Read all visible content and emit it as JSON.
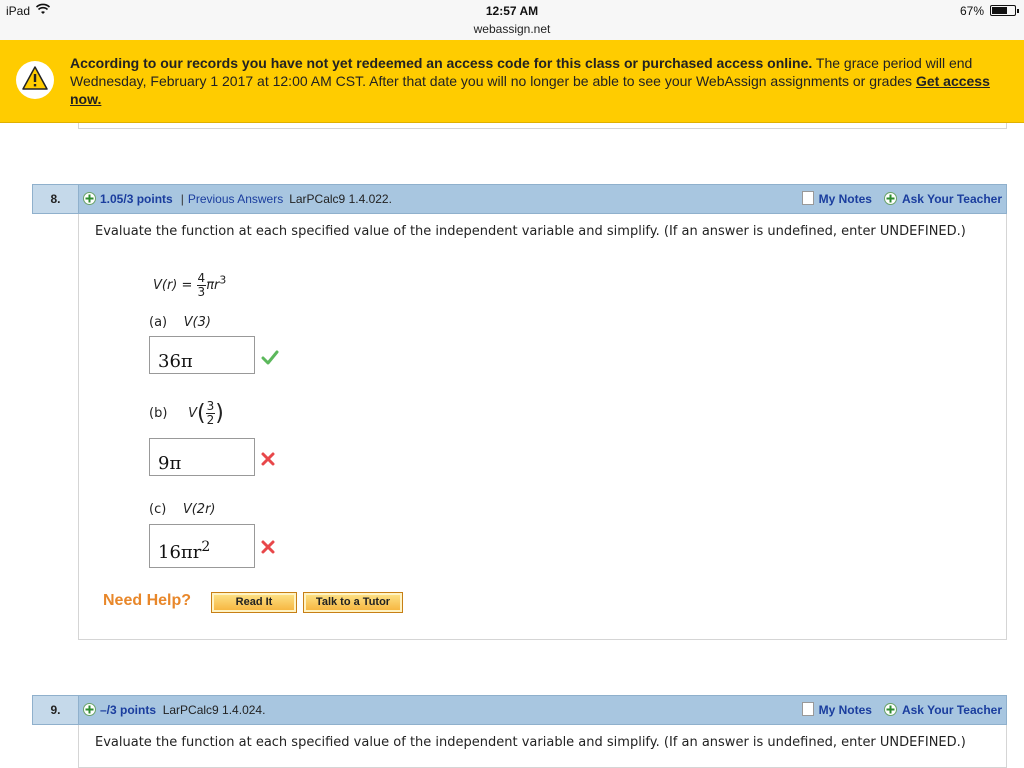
{
  "status_bar": {
    "device": "iPad",
    "time": "12:57 AM",
    "url": "webassign.net",
    "battery": "67%",
    "battery_level": 0.67
  },
  "banner": {
    "bold_text": "According to our records you have not yet redeemed an access code for this class or purchased access online.",
    "text": " The grace period will end Wednesday, February 1 2017 at 12:00 AM CST. After that date you will no longer be able to see your WebAssign assignments or grades ",
    "link": "Get access now."
  },
  "questions": [
    {
      "number": "8.",
      "points": "1.05/3 points",
      "separator": "|",
      "previous_answers": "Previous Answers",
      "code": "LarPCalc9 1.4.022.",
      "my_notes": "My Notes",
      "ask_teacher": "Ask Your Teacher",
      "prompt": "Evaluate the function at each specified value of the independent variable and simplify. (If an answer is undefined, enter UNDEFINED.)",
      "formula": {
        "lhs": "V(r) = ",
        "frac_num": "4",
        "frac_den": "3",
        "rhs": "πr",
        "exp": "3"
      },
      "parts": [
        {
          "label": "(a)",
          "arg": "V(3)",
          "answer": "36π",
          "answer_exp": "",
          "result": "correct"
        },
        {
          "label": "(b)",
          "arg_fn": "V",
          "arg_num": "3",
          "arg_den": "2",
          "answer": "9π",
          "answer_exp": "",
          "result": "incorrect"
        },
        {
          "label": "(c)",
          "arg": "V(2r)",
          "answer": "16πr",
          "answer_exp": "2",
          "result": "incorrect"
        }
      ],
      "need_help": "Need Help?",
      "read_it": "Read It",
      "talk_tutor": "Talk to a Tutor"
    },
    {
      "number": "9.",
      "points": "–/3 points",
      "code": "LarPCalc9 1.4.024.",
      "my_notes": "My Notes",
      "ask_teacher": "Ask Your Teacher",
      "prompt": "Evaluate the function at each specified value of the independent variable and simplify. (If an answer is undefined, enter UNDEFINED.)"
    }
  ],
  "colors": {
    "banner": "#ffcc00",
    "header": "#a8c6e0",
    "link": "#1a3d9e",
    "correct": "#5cb85c",
    "incorrect": "#e8474a",
    "help": "#e8872a"
  }
}
